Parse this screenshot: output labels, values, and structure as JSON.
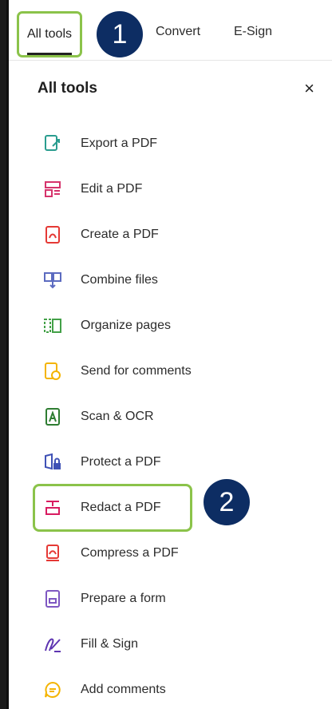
{
  "tabs": {
    "all_tools": "All tools",
    "convert": "Convert",
    "esign": "E-Sign"
  },
  "callouts": {
    "one": "1",
    "two": "2"
  },
  "panel": {
    "title": "All tools",
    "close": "×"
  },
  "tools": [
    {
      "label": "Export a PDF",
      "icon": "export-pdf-icon",
      "color": "#2a9d8f"
    },
    {
      "label": "Edit a PDF",
      "icon": "edit-pdf-icon",
      "color": "#d6336c"
    },
    {
      "label": "Create a PDF",
      "icon": "create-pdf-icon",
      "color": "#e53935"
    },
    {
      "label": "Combine files",
      "icon": "combine-files-icon",
      "color": "#5c6bc0"
    },
    {
      "label": "Organize pages",
      "icon": "organize-pages-icon",
      "color": "#43a047"
    },
    {
      "label": "Send for comments",
      "icon": "send-comments-icon",
      "color": "#f4b400"
    },
    {
      "label": "Scan & OCR",
      "icon": "scan-ocr-icon",
      "color": "#2e7d32"
    },
    {
      "label": "Protect a PDF",
      "icon": "protect-pdf-icon",
      "color": "#3f51b5"
    },
    {
      "label": "Redact a PDF",
      "icon": "redact-pdf-icon",
      "color": "#d81b60"
    },
    {
      "label": "Compress a PDF",
      "icon": "compress-pdf-icon",
      "color": "#e53935"
    },
    {
      "label": "Prepare a form",
      "icon": "prepare-form-icon",
      "color": "#7e57c2"
    },
    {
      "label": "Fill & Sign",
      "icon": "fill-sign-icon",
      "color": "#5e35b1"
    },
    {
      "label": "Add comments",
      "icon": "add-comments-icon",
      "color": "#f4b400"
    }
  ]
}
